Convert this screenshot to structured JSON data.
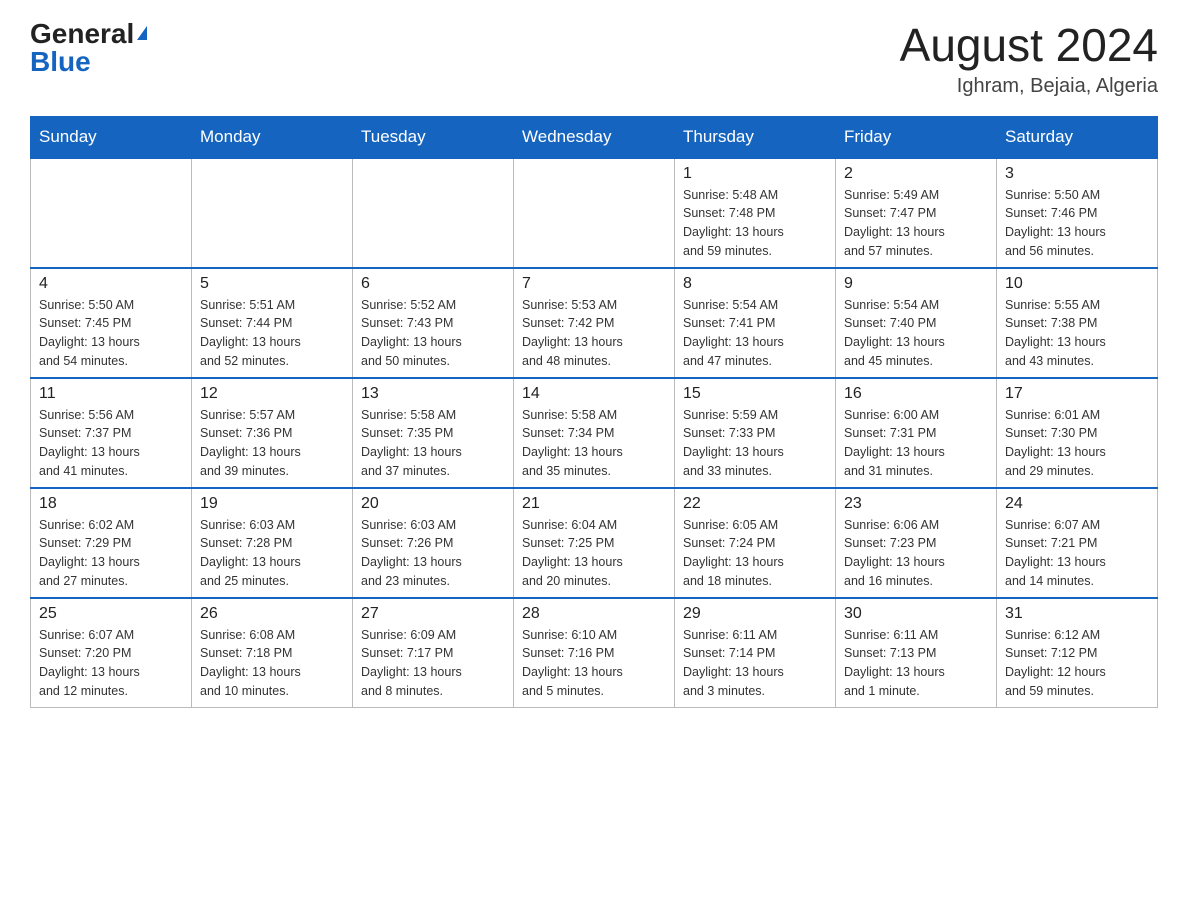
{
  "header": {
    "logo_general": "General",
    "logo_blue": "Blue",
    "month_title": "August 2024",
    "location": "Ighram, Bejaia, Algeria"
  },
  "calendar": {
    "days_of_week": [
      "Sunday",
      "Monday",
      "Tuesday",
      "Wednesday",
      "Thursday",
      "Friday",
      "Saturday"
    ],
    "weeks": [
      [
        {
          "day": "",
          "info": ""
        },
        {
          "day": "",
          "info": ""
        },
        {
          "day": "",
          "info": ""
        },
        {
          "day": "",
          "info": ""
        },
        {
          "day": "1",
          "info": "Sunrise: 5:48 AM\nSunset: 7:48 PM\nDaylight: 13 hours\nand 59 minutes."
        },
        {
          "day": "2",
          "info": "Sunrise: 5:49 AM\nSunset: 7:47 PM\nDaylight: 13 hours\nand 57 minutes."
        },
        {
          "day": "3",
          "info": "Sunrise: 5:50 AM\nSunset: 7:46 PM\nDaylight: 13 hours\nand 56 minutes."
        }
      ],
      [
        {
          "day": "4",
          "info": "Sunrise: 5:50 AM\nSunset: 7:45 PM\nDaylight: 13 hours\nand 54 minutes."
        },
        {
          "day": "5",
          "info": "Sunrise: 5:51 AM\nSunset: 7:44 PM\nDaylight: 13 hours\nand 52 minutes."
        },
        {
          "day": "6",
          "info": "Sunrise: 5:52 AM\nSunset: 7:43 PM\nDaylight: 13 hours\nand 50 minutes."
        },
        {
          "day": "7",
          "info": "Sunrise: 5:53 AM\nSunset: 7:42 PM\nDaylight: 13 hours\nand 48 minutes."
        },
        {
          "day": "8",
          "info": "Sunrise: 5:54 AM\nSunset: 7:41 PM\nDaylight: 13 hours\nand 47 minutes."
        },
        {
          "day": "9",
          "info": "Sunrise: 5:54 AM\nSunset: 7:40 PM\nDaylight: 13 hours\nand 45 minutes."
        },
        {
          "day": "10",
          "info": "Sunrise: 5:55 AM\nSunset: 7:38 PM\nDaylight: 13 hours\nand 43 minutes."
        }
      ],
      [
        {
          "day": "11",
          "info": "Sunrise: 5:56 AM\nSunset: 7:37 PM\nDaylight: 13 hours\nand 41 minutes."
        },
        {
          "day": "12",
          "info": "Sunrise: 5:57 AM\nSunset: 7:36 PM\nDaylight: 13 hours\nand 39 minutes."
        },
        {
          "day": "13",
          "info": "Sunrise: 5:58 AM\nSunset: 7:35 PM\nDaylight: 13 hours\nand 37 minutes."
        },
        {
          "day": "14",
          "info": "Sunrise: 5:58 AM\nSunset: 7:34 PM\nDaylight: 13 hours\nand 35 minutes."
        },
        {
          "day": "15",
          "info": "Sunrise: 5:59 AM\nSunset: 7:33 PM\nDaylight: 13 hours\nand 33 minutes."
        },
        {
          "day": "16",
          "info": "Sunrise: 6:00 AM\nSunset: 7:31 PM\nDaylight: 13 hours\nand 31 minutes."
        },
        {
          "day": "17",
          "info": "Sunrise: 6:01 AM\nSunset: 7:30 PM\nDaylight: 13 hours\nand 29 minutes."
        }
      ],
      [
        {
          "day": "18",
          "info": "Sunrise: 6:02 AM\nSunset: 7:29 PM\nDaylight: 13 hours\nand 27 minutes."
        },
        {
          "day": "19",
          "info": "Sunrise: 6:03 AM\nSunset: 7:28 PM\nDaylight: 13 hours\nand 25 minutes."
        },
        {
          "day": "20",
          "info": "Sunrise: 6:03 AM\nSunset: 7:26 PM\nDaylight: 13 hours\nand 23 minutes."
        },
        {
          "day": "21",
          "info": "Sunrise: 6:04 AM\nSunset: 7:25 PM\nDaylight: 13 hours\nand 20 minutes."
        },
        {
          "day": "22",
          "info": "Sunrise: 6:05 AM\nSunset: 7:24 PM\nDaylight: 13 hours\nand 18 minutes."
        },
        {
          "day": "23",
          "info": "Sunrise: 6:06 AM\nSunset: 7:23 PM\nDaylight: 13 hours\nand 16 minutes."
        },
        {
          "day": "24",
          "info": "Sunrise: 6:07 AM\nSunset: 7:21 PM\nDaylight: 13 hours\nand 14 minutes."
        }
      ],
      [
        {
          "day": "25",
          "info": "Sunrise: 6:07 AM\nSunset: 7:20 PM\nDaylight: 13 hours\nand 12 minutes."
        },
        {
          "day": "26",
          "info": "Sunrise: 6:08 AM\nSunset: 7:18 PM\nDaylight: 13 hours\nand 10 minutes."
        },
        {
          "day": "27",
          "info": "Sunrise: 6:09 AM\nSunset: 7:17 PM\nDaylight: 13 hours\nand 8 minutes."
        },
        {
          "day": "28",
          "info": "Sunrise: 6:10 AM\nSunset: 7:16 PM\nDaylight: 13 hours\nand 5 minutes."
        },
        {
          "day": "29",
          "info": "Sunrise: 6:11 AM\nSunset: 7:14 PM\nDaylight: 13 hours\nand 3 minutes."
        },
        {
          "day": "30",
          "info": "Sunrise: 6:11 AM\nSunset: 7:13 PM\nDaylight: 13 hours\nand 1 minute."
        },
        {
          "day": "31",
          "info": "Sunrise: 6:12 AM\nSunset: 7:12 PM\nDaylight: 12 hours\nand 59 minutes."
        }
      ]
    ]
  }
}
